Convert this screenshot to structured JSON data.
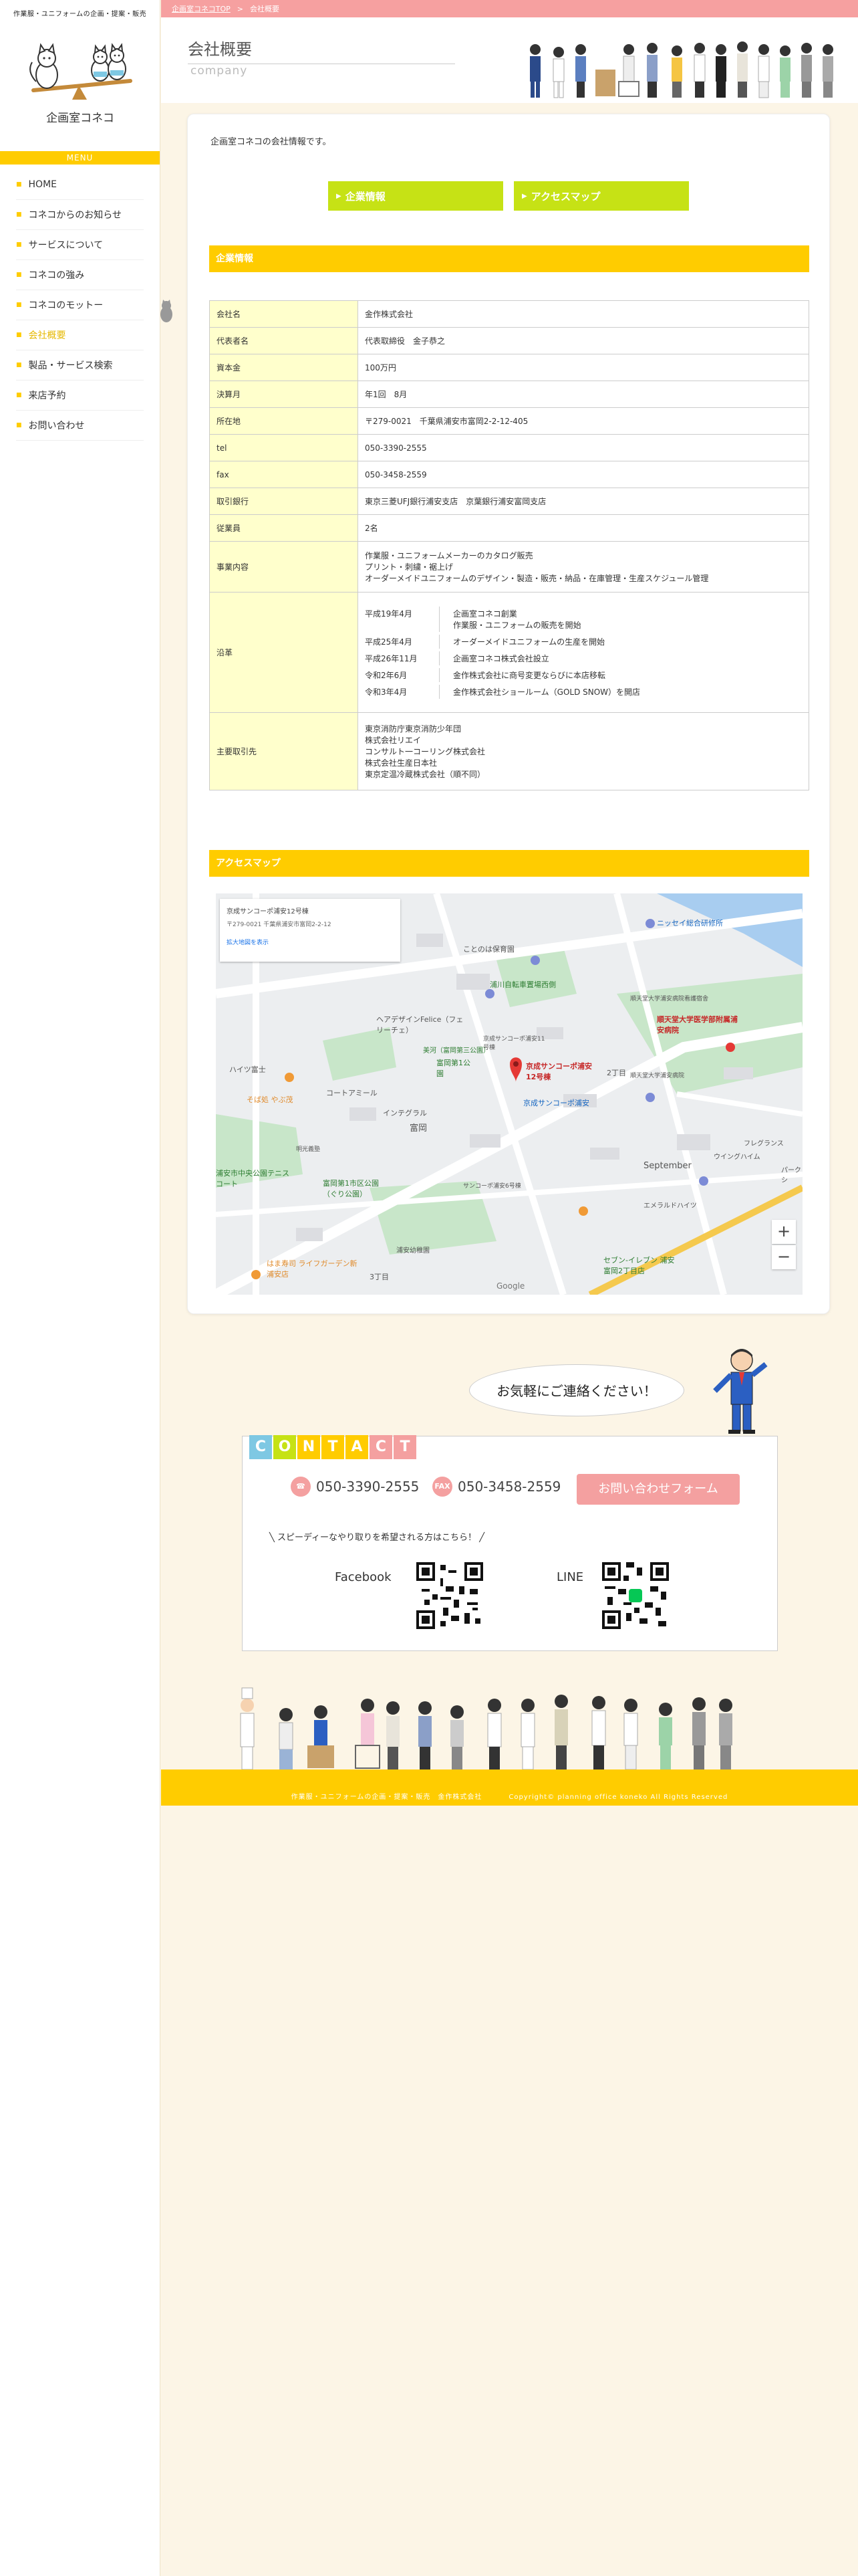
{
  "sidebar": {
    "tagline": "作業服・ユニフォームの企画・提案・販売",
    "logo_name": "企画室コネコ",
    "menu_label": "MENU",
    "nav": [
      {
        "label": "HOME",
        "active": false
      },
      {
        "label": "コネコからのお知らせ",
        "active": false
      },
      {
        "label": "サービスについて",
        "active": false
      },
      {
        "label": "コネコの強み",
        "active": false
      },
      {
        "label": "コネコのモットー",
        "active": false
      },
      {
        "label": "会社概要",
        "active": true
      },
      {
        "label": "製品・サービス検索",
        "active": false
      },
      {
        "label": "来店予約",
        "active": false
      },
      {
        "label": "お問い合わせ",
        "active": false
      }
    ]
  },
  "breadcrumb": {
    "home": "企画室コネコTOP",
    "separator": ">",
    "current": "会社概要"
  },
  "header": {
    "title": "会社概要",
    "subtitle": "company"
  },
  "main": {
    "intro": "企画室コネコの会社情報です。",
    "buttons": [
      {
        "label": "企業情報"
      },
      {
        "label": "アクセスマップ"
      }
    ],
    "company_section_title": "企業情報",
    "rows": {
      "company_name": {
        "key": "会社名",
        "value": "金作株式会社"
      },
      "representative": {
        "key": "代表者名",
        "value": "代表取締役　金子恭之"
      },
      "capital": {
        "key": "資本金",
        "value": "100万円"
      },
      "fiscal": {
        "key": "決算月",
        "value": "年1回　8月"
      },
      "address": {
        "key": "所在地",
        "value": "〒279-0021　千葉県浦安市富岡2-2-12-405"
      },
      "tel": {
        "key": "tel",
        "value": "050-3390-2555"
      },
      "fax": {
        "key": "fax",
        "value": "050-3458-2559"
      },
      "bank": {
        "key": "取引銀行",
        "value": "東京三菱UFJ銀行浦安支店　京葉銀行浦安富岡支店"
      },
      "employees": {
        "key": "従業員",
        "value": "2名"
      },
      "business": {
        "key": "事業内容",
        "lines": [
          "作業服・ユニフォームメーカーのカタログ販売",
          "プリント・刺繍・裾上げ",
          "オーダーメイドユニフォームのデザイン・製造・販売・納品・在庫管理・生産スケジュール管理"
        ]
      },
      "history": {
        "key": "沿革",
        "items": [
          {
            "date": "平成19年4月",
            "lines": [
              "企画室コネコ創業",
              "作業服・ユニフォームの販売を開始"
            ]
          },
          {
            "date": "平成25年4月",
            "lines": [
              "オーダーメイドユニフォームの生産を開始"
            ]
          },
          {
            "date": "平成26年11月",
            "lines": [
              "企画室コネコ株式会社設立"
            ]
          },
          {
            "date": "令和2年6月",
            "lines": [
              "金作株式会社に商号変更ならびに本店移転"
            ]
          },
          {
            "date": "令和3年4月",
            "lines": [
              "金作株式会社ショールーム（GOLD SNOW）を開店"
            ]
          }
        ]
      },
      "clients": {
        "key": "主要取引先",
        "lines": [
          "東京消防庁東京消防少年団",
          "株式会社リエイ",
          "コンサルト一コーリング株式会社",
          "株式会社生産日本社",
          "東京定温冷蔵株式会社（順不同）"
        ]
      }
    },
    "access_section_title": "アクセスマップ"
  },
  "map": {
    "info_title": "京成サンコーポ浦安12号棟",
    "info_address": "〒279-0021 千葉県浦安市富岡2-2-12",
    "info_link": "拡大地図を表示",
    "labels": {
      "nissei": "ニッセイ総合研修所",
      "kotonoha": "ことのは保育園",
      "bike": "浦川自転車置場西側",
      "juntendo": "順天堂大学医学部附属浦安病院",
      "juntendo_sub": "順天堂大学浦安病院",
      "juntendo_nurse": "順天堂大学浦安病院看護宿舎",
      "felice": "ヘアデザインFelice（フェリーチェ）",
      "sunport12": "京成サンコーポ浦安12号棟",
      "sunport11": "京成サンコーポ浦安11号棟",
      "sunport_e": "京成サンコーポ浦安",
      "tomioka_park1": "富岡第1公園",
      "tomioka_park2": "富岡第1市区公園（ぐり公園）",
      "seiwa": "浦安市中央公園テニスコート",
      "mihori": "美河（富岡第三公園）",
      "hattori": "ハイツ富士",
      "soba": "そば処 やぶ茂",
      "coat": "コートアミール",
      "interpark": "インテグラル",
      "tomioka_label": "富岡",
      "sanchome": "3丁目",
      "nichome": "2丁目",
      "sept_eleven": "セブン-イレブン 浦安富岡2丁目店",
      "september": "September",
      "hamazushi": "はま寿司 ライフガーデン新浦安店",
      "meikoudai": "明光義塾",
      "sankoupo_a": "サンコーポ浦安6号棟",
      "lifeplus": "フレグランス",
      "wings": "ウイングハイム",
      "elega": "エメラルドハイツ",
      "kindergarten": "浦安幼稚園",
      "park": "パークシ",
      "google": "Google"
    },
    "zoom_in": "+",
    "zoom_out": "−"
  },
  "contact": {
    "bubble": "お気軽にご連絡ください！",
    "title_letters": [
      "C",
      "O",
      "N",
      "T",
      "A",
      "C",
      "T"
    ],
    "title_colors": [
      "#7ec8e3",
      "#c6e215",
      "#ffcc00",
      "#ffcc00",
      "#ffcc00",
      "#f4a0a0",
      "#f4a0a0"
    ],
    "tel_label": "TEL",
    "tel": "050-3390-2555",
    "fax_label": "FAX",
    "fax": "050-3458-2559",
    "form_button": "お問い合わせフォーム",
    "speedy_text": "スピーディーなやり取りを希望される方はこちら！",
    "facebook_label": "Facebook",
    "line_label": "LINE"
  },
  "footer": {
    "left": "作業服・ユニフォームの企画・提案・販売　金作株式会社",
    "right": "Copyright© planning office koneko All Rights Reserved"
  }
}
